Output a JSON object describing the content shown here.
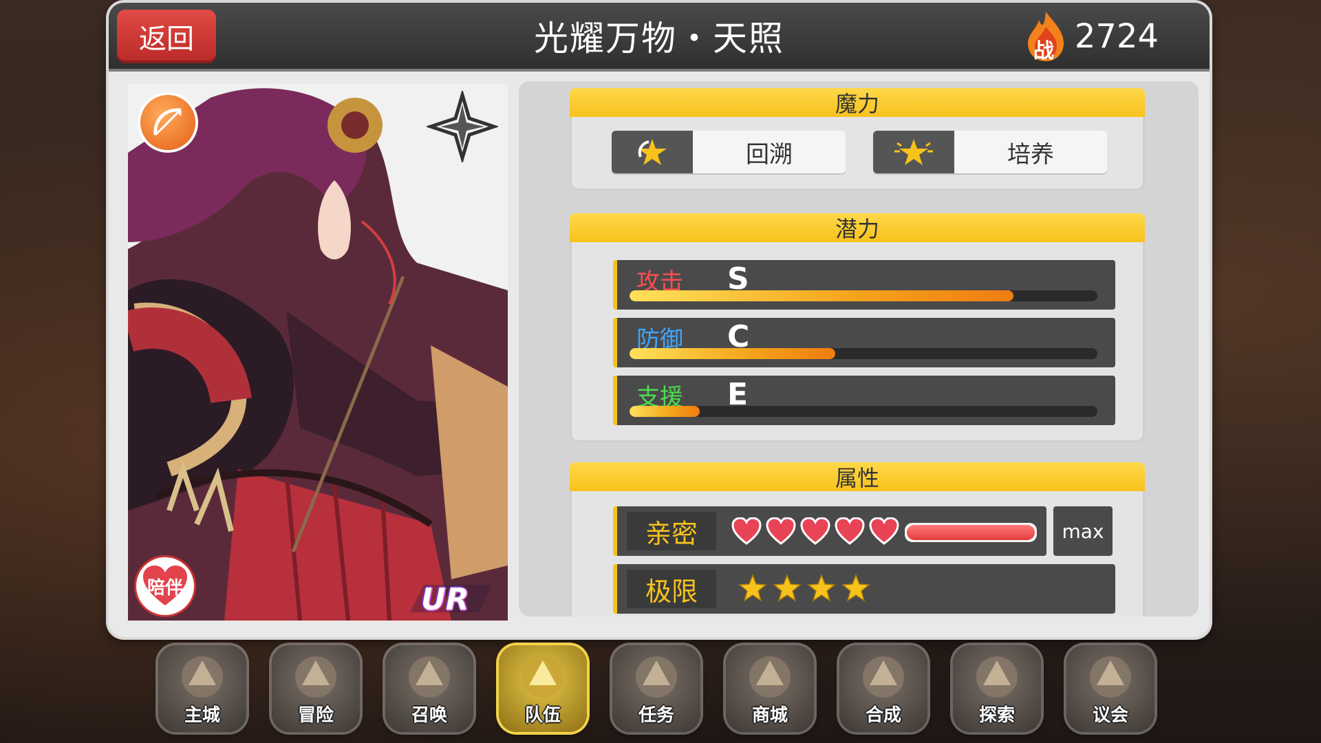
{
  "header": {
    "back_label": "返回",
    "title": "光耀万物・天照",
    "power_icon_text": "战",
    "power_value": "2724"
  },
  "character": {
    "class_icon": "bow-icon",
    "element_icon": "wind-element-icon",
    "companion_label": "陪伴",
    "rarity": "UR"
  },
  "magic": {
    "title": "魔力",
    "buttons": [
      {
        "icon": "rewind-star-icon",
        "label": "回溯"
      },
      {
        "icon": "sparkle-star-icon",
        "label": "培养"
      }
    ]
  },
  "potential": {
    "title": "潜力",
    "stats": [
      {
        "label": "攻击",
        "grade": "S",
        "level": 0.82,
        "color": "#ff4d4d"
      },
      {
        "label": "防御",
        "grade": "C",
        "level": 0.44,
        "color": "#3ea6ff"
      },
      {
        "label": "支援",
        "grade": "E",
        "level": 0.15,
        "color": "#4ddc4d"
      }
    ]
  },
  "attributes": {
    "title": "属性",
    "affinity_label": "亲密",
    "affinity_hearts": 5,
    "affinity_level": 1.0,
    "affinity_max": "max",
    "limit_label": "极限",
    "limit_stars": 4
  },
  "nav": {
    "items": [
      {
        "label": "主城",
        "icon": "crown-icon"
      },
      {
        "label": "冒险",
        "icon": "swords-icon"
      },
      {
        "label": "召唤",
        "icon": "card-icon"
      },
      {
        "label": "队伍",
        "icon": "wings-emblem-icon",
        "active": true
      },
      {
        "label": "任务",
        "icon": "book-icon"
      },
      {
        "label": "商城",
        "icon": "tree-shop-icon"
      },
      {
        "label": "合成",
        "icon": "potion-icon"
      },
      {
        "label": "探索",
        "icon": "shovel-icon"
      },
      {
        "label": "议会",
        "icon": "council-emblem-icon"
      }
    ]
  }
}
